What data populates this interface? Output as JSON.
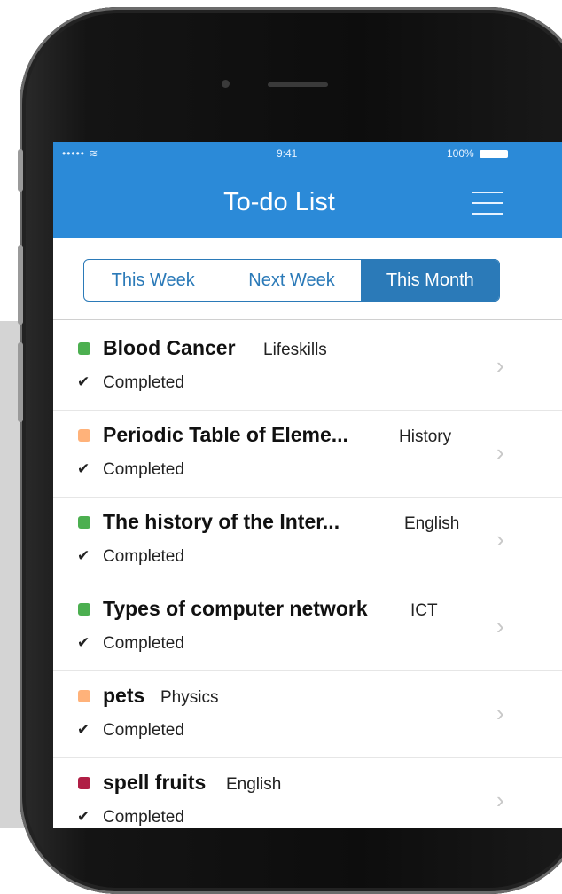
{
  "status_bar": {
    "signal": "••••• ≋",
    "time": "9:41",
    "battery": "100%"
  },
  "header": {
    "title": "To-do List"
  },
  "tabs": [
    {
      "label": "This Week",
      "active": false
    },
    {
      "label": "Next Week",
      "active": false
    },
    {
      "label": "This Month",
      "active": true
    }
  ],
  "colors": {
    "header": "#2b8ad8",
    "segment": "#2b7ab8",
    "green": "#4caf50",
    "orange": "#ffb27a",
    "crimson": "#b01e45"
  },
  "items": [
    {
      "title": "Blood Cancer",
      "subject": "Lifeskills",
      "status": "Completed",
      "color": "#4caf50"
    },
    {
      "title": "Periodic Table of Eleme...",
      "subject": "History",
      "status": "Completed",
      "color": "#ffb27a"
    },
    {
      "title": "The history of the Inter...",
      "subject": "English",
      "status": "Completed",
      "color": "#4caf50"
    },
    {
      "title": "Types of computer network",
      "subject": "ICT",
      "status": "Completed",
      "color": "#4caf50"
    },
    {
      "title": "pets",
      "subject": "Physics",
      "status": "Completed",
      "color": "#ffb27a"
    },
    {
      "title": "spell fruits",
      "subject": "English",
      "status": "Completed",
      "color": "#b01e45"
    }
  ]
}
